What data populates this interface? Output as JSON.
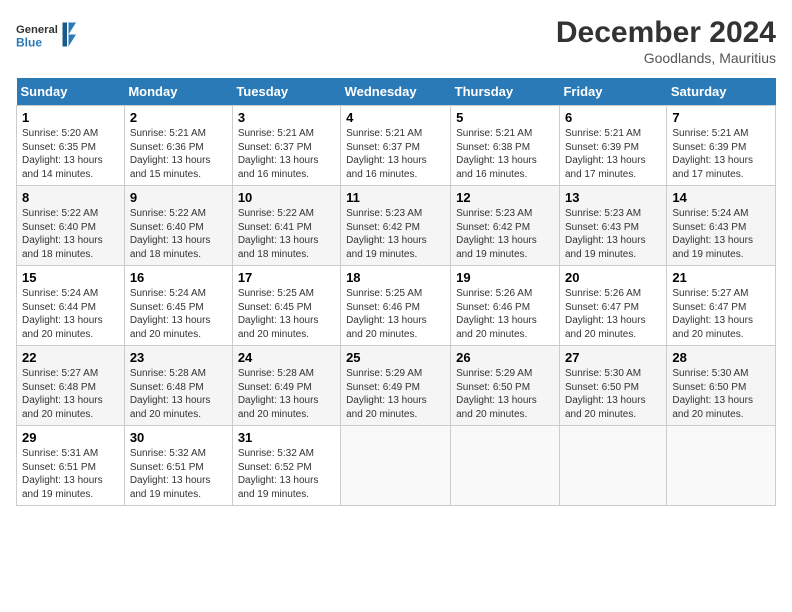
{
  "header": {
    "logo_general": "General",
    "logo_blue": "Blue",
    "month_year": "December 2024",
    "location": "Goodlands, Mauritius"
  },
  "days_of_week": [
    "Sunday",
    "Monday",
    "Tuesday",
    "Wednesday",
    "Thursday",
    "Friday",
    "Saturday"
  ],
  "weeks": [
    [
      {
        "day": "1",
        "info": "Sunrise: 5:20 AM\nSunset: 6:35 PM\nDaylight: 13 hours\nand 14 minutes."
      },
      {
        "day": "2",
        "info": "Sunrise: 5:21 AM\nSunset: 6:36 PM\nDaylight: 13 hours\nand 15 minutes."
      },
      {
        "day": "3",
        "info": "Sunrise: 5:21 AM\nSunset: 6:37 PM\nDaylight: 13 hours\nand 16 minutes."
      },
      {
        "day": "4",
        "info": "Sunrise: 5:21 AM\nSunset: 6:37 PM\nDaylight: 13 hours\nand 16 minutes."
      },
      {
        "day": "5",
        "info": "Sunrise: 5:21 AM\nSunset: 6:38 PM\nDaylight: 13 hours\nand 16 minutes."
      },
      {
        "day": "6",
        "info": "Sunrise: 5:21 AM\nSunset: 6:39 PM\nDaylight: 13 hours\nand 17 minutes."
      },
      {
        "day": "7",
        "info": "Sunrise: 5:21 AM\nSunset: 6:39 PM\nDaylight: 13 hours\nand 17 minutes."
      }
    ],
    [
      {
        "day": "8",
        "info": "Sunrise: 5:22 AM\nSunset: 6:40 PM\nDaylight: 13 hours\nand 18 minutes."
      },
      {
        "day": "9",
        "info": "Sunrise: 5:22 AM\nSunset: 6:40 PM\nDaylight: 13 hours\nand 18 minutes."
      },
      {
        "day": "10",
        "info": "Sunrise: 5:22 AM\nSunset: 6:41 PM\nDaylight: 13 hours\nand 18 minutes."
      },
      {
        "day": "11",
        "info": "Sunrise: 5:23 AM\nSunset: 6:42 PM\nDaylight: 13 hours\nand 19 minutes."
      },
      {
        "day": "12",
        "info": "Sunrise: 5:23 AM\nSunset: 6:42 PM\nDaylight: 13 hours\nand 19 minutes."
      },
      {
        "day": "13",
        "info": "Sunrise: 5:23 AM\nSunset: 6:43 PM\nDaylight: 13 hours\nand 19 minutes."
      },
      {
        "day": "14",
        "info": "Sunrise: 5:24 AM\nSunset: 6:43 PM\nDaylight: 13 hours\nand 19 minutes."
      }
    ],
    [
      {
        "day": "15",
        "info": "Sunrise: 5:24 AM\nSunset: 6:44 PM\nDaylight: 13 hours\nand 20 minutes."
      },
      {
        "day": "16",
        "info": "Sunrise: 5:24 AM\nSunset: 6:45 PM\nDaylight: 13 hours\nand 20 minutes."
      },
      {
        "day": "17",
        "info": "Sunrise: 5:25 AM\nSunset: 6:45 PM\nDaylight: 13 hours\nand 20 minutes."
      },
      {
        "day": "18",
        "info": "Sunrise: 5:25 AM\nSunset: 6:46 PM\nDaylight: 13 hours\nand 20 minutes."
      },
      {
        "day": "19",
        "info": "Sunrise: 5:26 AM\nSunset: 6:46 PM\nDaylight: 13 hours\nand 20 minutes."
      },
      {
        "day": "20",
        "info": "Sunrise: 5:26 AM\nSunset: 6:47 PM\nDaylight: 13 hours\nand 20 minutes."
      },
      {
        "day": "21",
        "info": "Sunrise: 5:27 AM\nSunset: 6:47 PM\nDaylight: 13 hours\nand 20 minutes."
      }
    ],
    [
      {
        "day": "22",
        "info": "Sunrise: 5:27 AM\nSunset: 6:48 PM\nDaylight: 13 hours\nand 20 minutes."
      },
      {
        "day": "23",
        "info": "Sunrise: 5:28 AM\nSunset: 6:48 PM\nDaylight: 13 hours\nand 20 minutes."
      },
      {
        "day": "24",
        "info": "Sunrise: 5:28 AM\nSunset: 6:49 PM\nDaylight: 13 hours\nand 20 minutes."
      },
      {
        "day": "25",
        "info": "Sunrise: 5:29 AM\nSunset: 6:49 PM\nDaylight: 13 hours\nand 20 minutes."
      },
      {
        "day": "26",
        "info": "Sunrise: 5:29 AM\nSunset: 6:50 PM\nDaylight: 13 hours\nand 20 minutes."
      },
      {
        "day": "27",
        "info": "Sunrise: 5:30 AM\nSunset: 6:50 PM\nDaylight: 13 hours\nand 20 minutes."
      },
      {
        "day": "28",
        "info": "Sunrise: 5:30 AM\nSunset: 6:50 PM\nDaylight: 13 hours\nand 20 minutes."
      }
    ],
    [
      {
        "day": "29",
        "info": "Sunrise: 5:31 AM\nSunset: 6:51 PM\nDaylight: 13 hours\nand 19 minutes."
      },
      {
        "day": "30",
        "info": "Sunrise: 5:32 AM\nSunset: 6:51 PM\nDaylight: 13 hours\nand 19 minutes."
      },
      {
        "day": "31",
        "info": "Sunrise: 5:32 AM\nSunset: 6:52 PM\nDaylight: 13 hours\nand 19 minutes."
      },
      {
        "day": "",
        "info": ""
      },
      {
        "day": "",
        "info": ""
      },
      {
        "day": "",
        "info": ""
      },
      {
        "day": "",
        "info": ""
      }
    ]
  ]
}
